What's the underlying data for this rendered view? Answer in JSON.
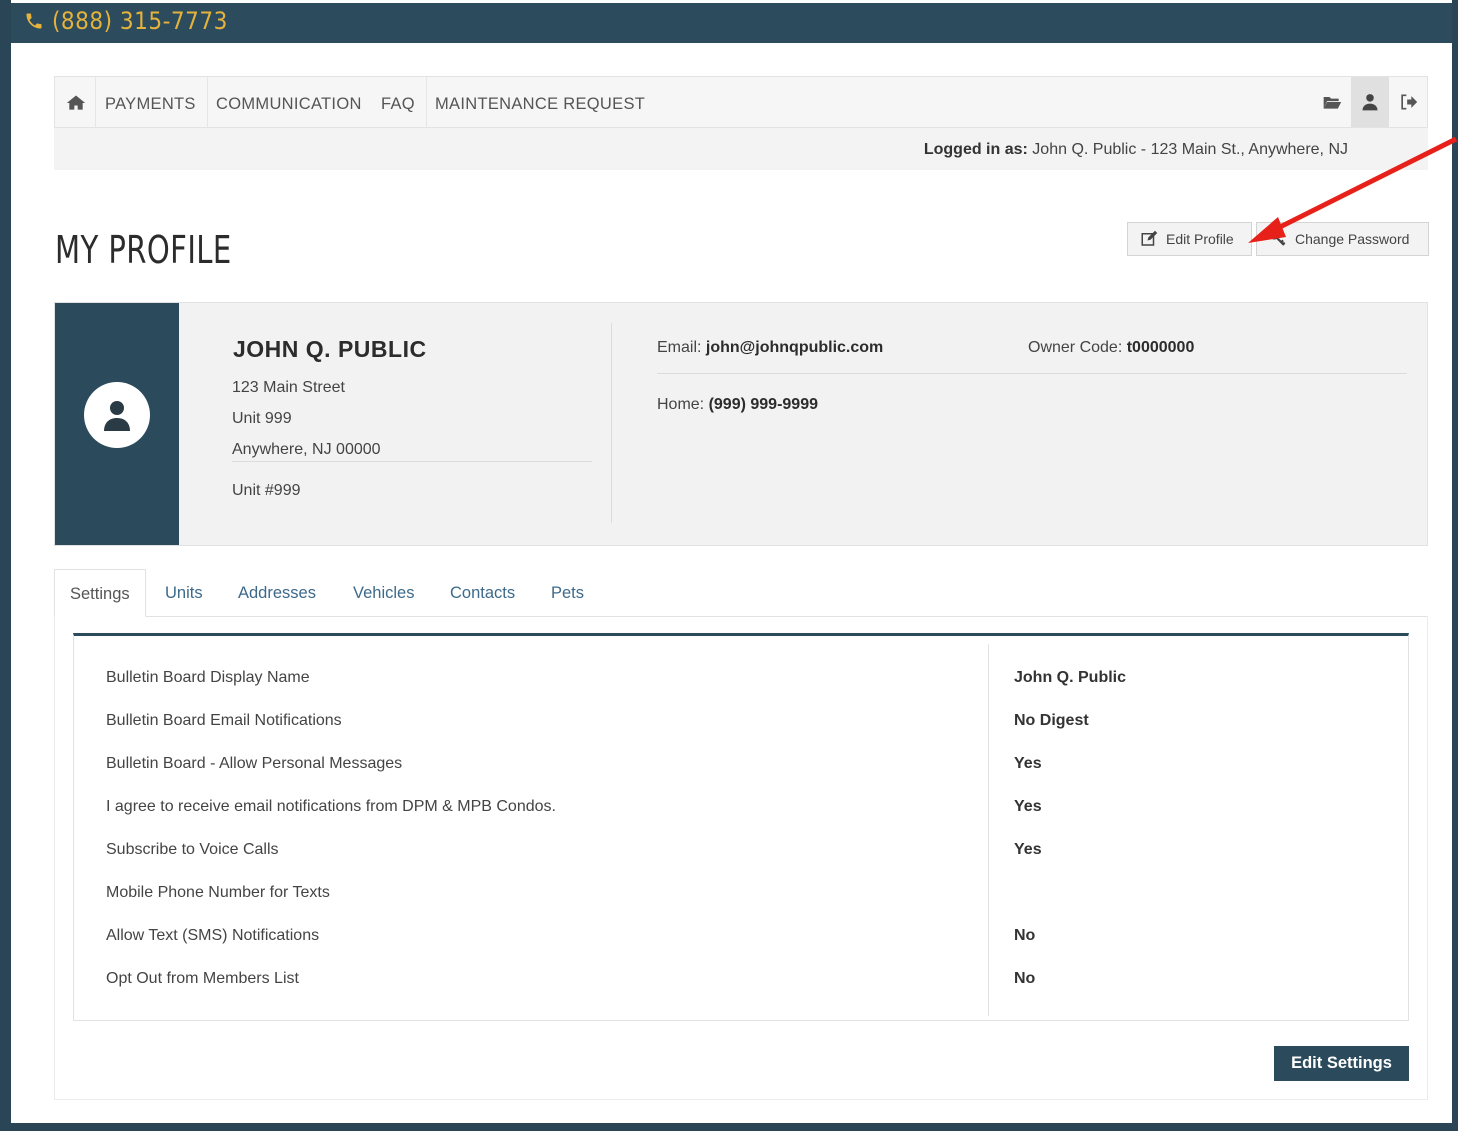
{
  "topbar": {
    "phone": "(888) 315-7773"
  },
  "nav": {
    "items": [
      "PAYMENTS",
      "COMMUNICATION",
      "FAQ",
      "MAINTENANCE REQUEST"
    ]
  },
  "login": {
    "label": "Logged in as:",
    "value": "John Q. Public - 123 Main St., Anywhere, NJ"
  },
  "page": {
    "title": "MY PROFILE",
    "edit_profile": "Edit Profile",
    "change_password": "Change Password"
  },
  "profile": {
    "name": "JOHN Q. PUBLIC",
    "street": "123 Main Street",
    "unit_line": "Unit 999",
    "city": "Anywhere, NJ 00000",
    "unit_number": "Unit #999",
    "email_label": "Email:",
    "email": "john@johnqpublic.com",
    "owner_code_label": "Owner Code:",
    "owner_code": "t0000000",
    "home_label": "Home:",
    "home_phone": "(999) 999-9999"
  },
  "tabs": [
    "Settings",
    "Units",
    "Addresses",
    "Vehicles",
    "Contacts",
    "Pets"
  ],
  "settings": [
    {
      "label": "Bulletin Board Display Name",
      "value": "John Q. Public"
    },
    {
      "label": "Bulletin Board Email Notifications",
      "value": "No Digest"
    },
    {
      "label": "Bulletin Board - Allow Personal Messages",
      "value": "Yes"
    },
    {
      "label": "I agree to receive email notifications from DPM & MPB Condos.",
      "value": "Yes"
    },
    {
      "label": "Subscribe to Voice Calls",
      "value": "Yes"
    },
    {
      "label": "Mobile Phone Number for Texts",
      "value": ""
    },
    {
      "label": "Allow Text (SMS) Notifications",
      "value": "No"
    },
    {
      "label": "Opt Out from Members List",
      "value": "No"
    }
  ],
  "edit_settings": "Edit Settings",
  "colors": {
    "brand": "#2b4b5d",
    "phone": "#e5b33c",
    "link": "#3d6a8a",
    "annotation": "#e8201a"
  }
}
